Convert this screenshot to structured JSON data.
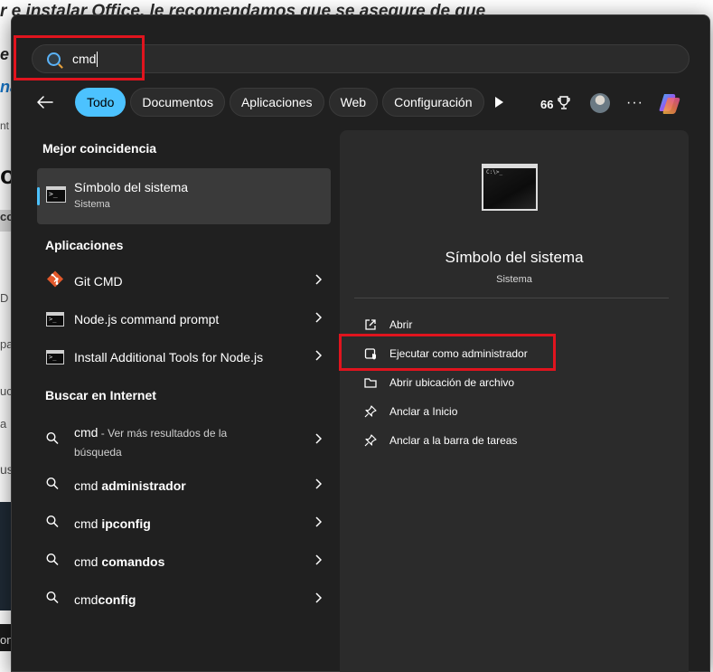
{
  "background": {
    "fragment_top": "r e instalar Office, le recomendamos que se asegure de que",
    "fragment_e": "e",
    "fragment_na": "na",
    "fragment_nt": "nt",
    "fragment_o": "o",
    "fragment_co": "co",
    "fragment_d": "D",
    "fragment_pa": "pa",
    "fragment_uc": "uc",
    "fragment_a": "a",
    "fragment_us": "us",
    "fragment_on": "on"
  },
  "search": {
    "query": "cmd",
    "icon": "search-icon"
  },
  "filters": {
    "back_icon": "back-arrow-icon",
    "chips": [
      {
        "label": "Todo",
        "active": true
      },
      {
        "label": "Documentos",
        "active": false
      },
      {
        "label": "Aplicaciones",
        "active": false
      },
      {
        "label": "Web",
        "active": false
      },
      {
        "label": "Configuración",
        "active": false
      }
    ],
    "rewards_points": "66"
  },
  "best_match": {
    "heading": "Mejor coincidencia",
    "title": "Símbolo del sistema",
    "subtitle": "Sistema"
  },
  "apps": {
    "heading": "Aplicaciones",
    "items": [
      {
        "label": "Git CMD",
        "icon": "git-icon"
      },
      {
        "label": "Node.js command prompt",
        "icon": "cmd-icon"
      },
      {
        "label": "Install Additional Tools for Node.js",
        "icon": "cmd-icon"
      }
    ]
  },
  "web": {
    "heading": "Buscar en Internet",
    "first": {
      "term": "cmd",
      "suffix": " - Ver más resultados de la",
      "suffix2": "búsqueda"
    },
    "items": [
      {
        "plain": "cmd ",
        "bold": "administrador"
      },
      {
        "plain": "cmd ",
        "bold": "ipconfig"
      },
      {
        "plain": "cmd ",
        "bold": "comandos"
      },
      {
        "plain": "cmd",
        "bold": "config"
      }
    ]
  },
  "preview": {
    "title": "Símbolo del sistema",
    "subtitle": "Sistema",
    "actions": [
      {
        "label": "Abrir",
        "icon": "open-external-icon"
      },
      {
        "label": "Ejecutar como administrador",
        "icon": "shield-admin-icon"
      },
      {
        "label": "Abrir ubicación de archivo",
        "icon": "folder-icon"
      },
      {
        "label": "Anclar a Inicio",
        "icon": "pin-icon"
      },
      {
        "label": "Anclar a la barra de tareas",
        "icon": "pin-icon"
      }
    ]
  },
  "colors": {
    "accent": "#4cc2ff",
    "panel_bg": "#202020",
    "annotation_red": "#e0141e"
  }
}
